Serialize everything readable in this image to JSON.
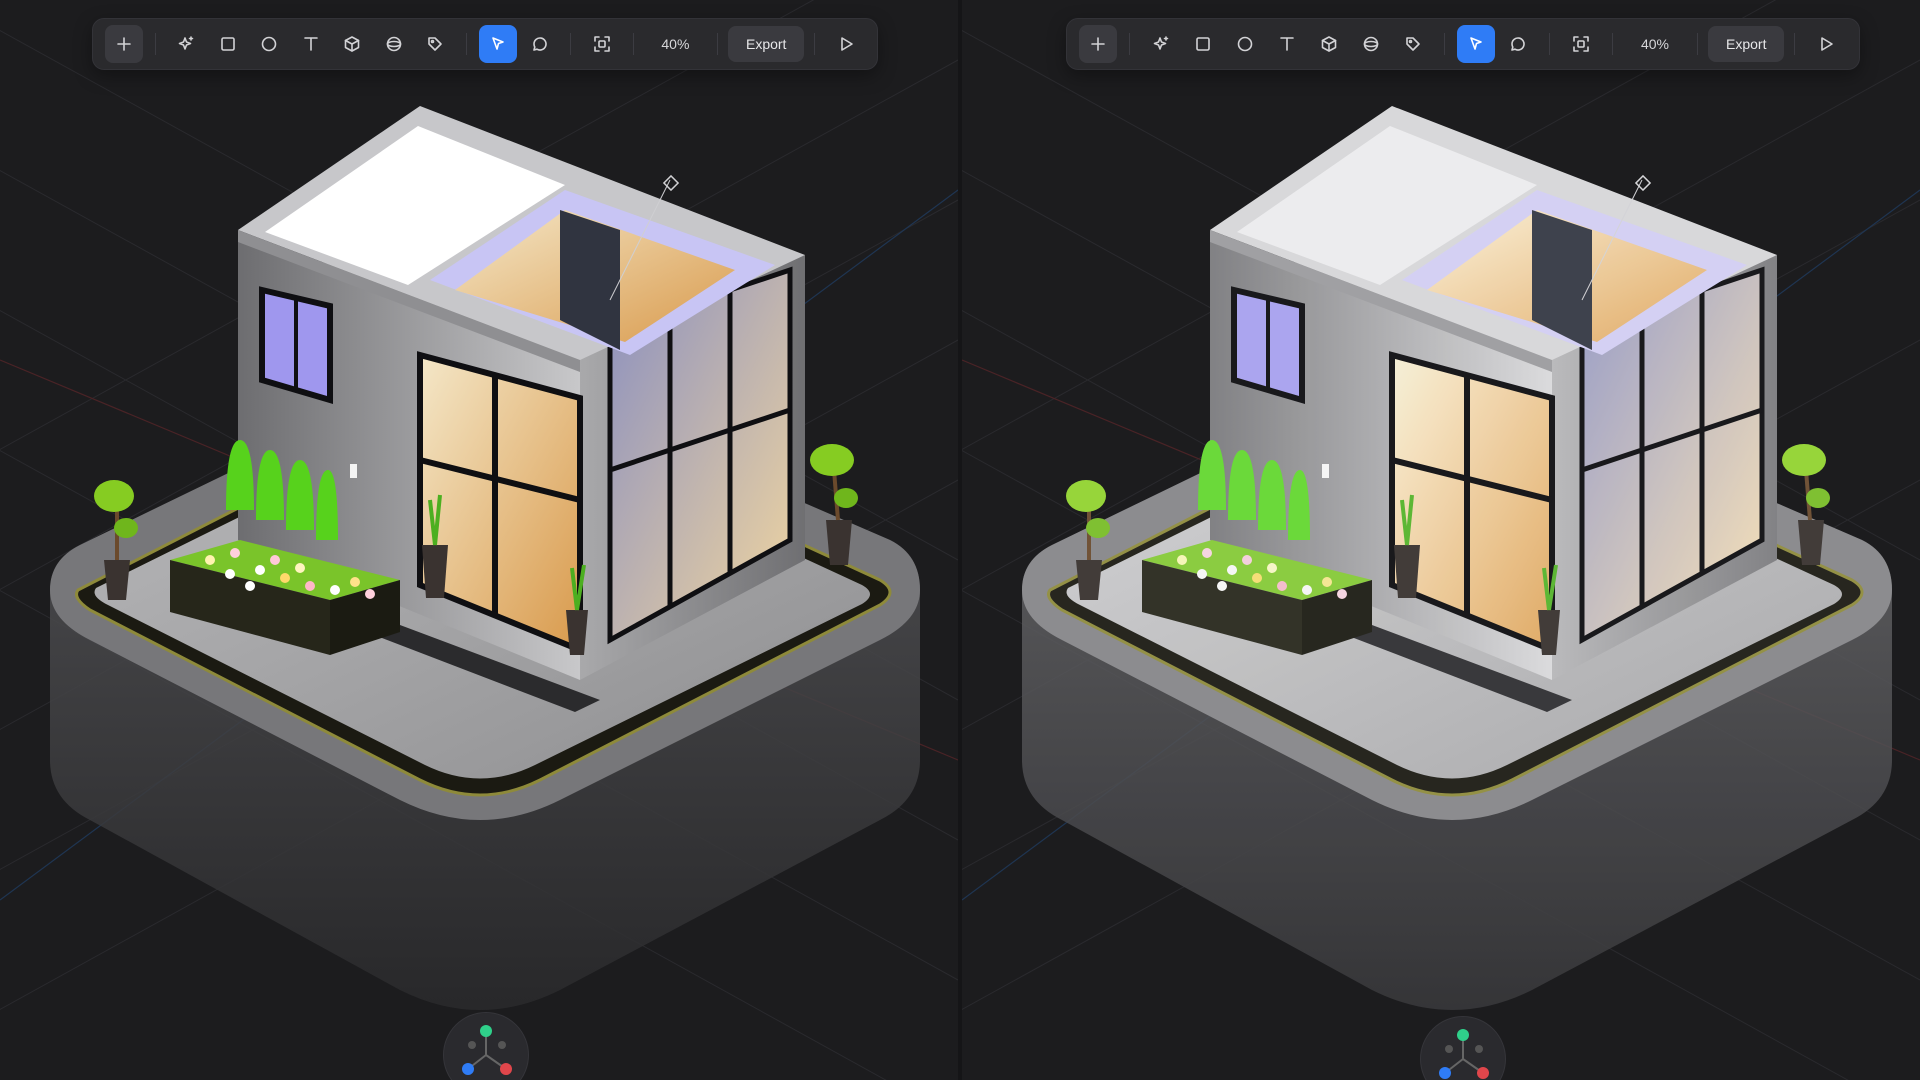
{
  "toolbar": {
    "zoom_label": "40%",
    "export_label": "Export",
    "tools": [
      "plus-icon",
      "sparkle-icon",
      "rectangle-icon",
      "ellipse-icon",
      "text-icon",
      "cube-icon",
      "sphere-icon",
      "tag-icon",
      "cursor-icon",
      "comment-icon",
      "frame-icon",
      "play-icon"
    ],
    "active_tool": "cursor-icon"
  },
  "colors": {
    "background": "#1c1c1e",
    "toolbar": "#2a2a2d",
    "accent": "#2f7cf6",
    "axis_x": "#e0464b",
    "axis_y": "#2fd08a",
    "axis_z": "#2f7cf6"
  }
}
